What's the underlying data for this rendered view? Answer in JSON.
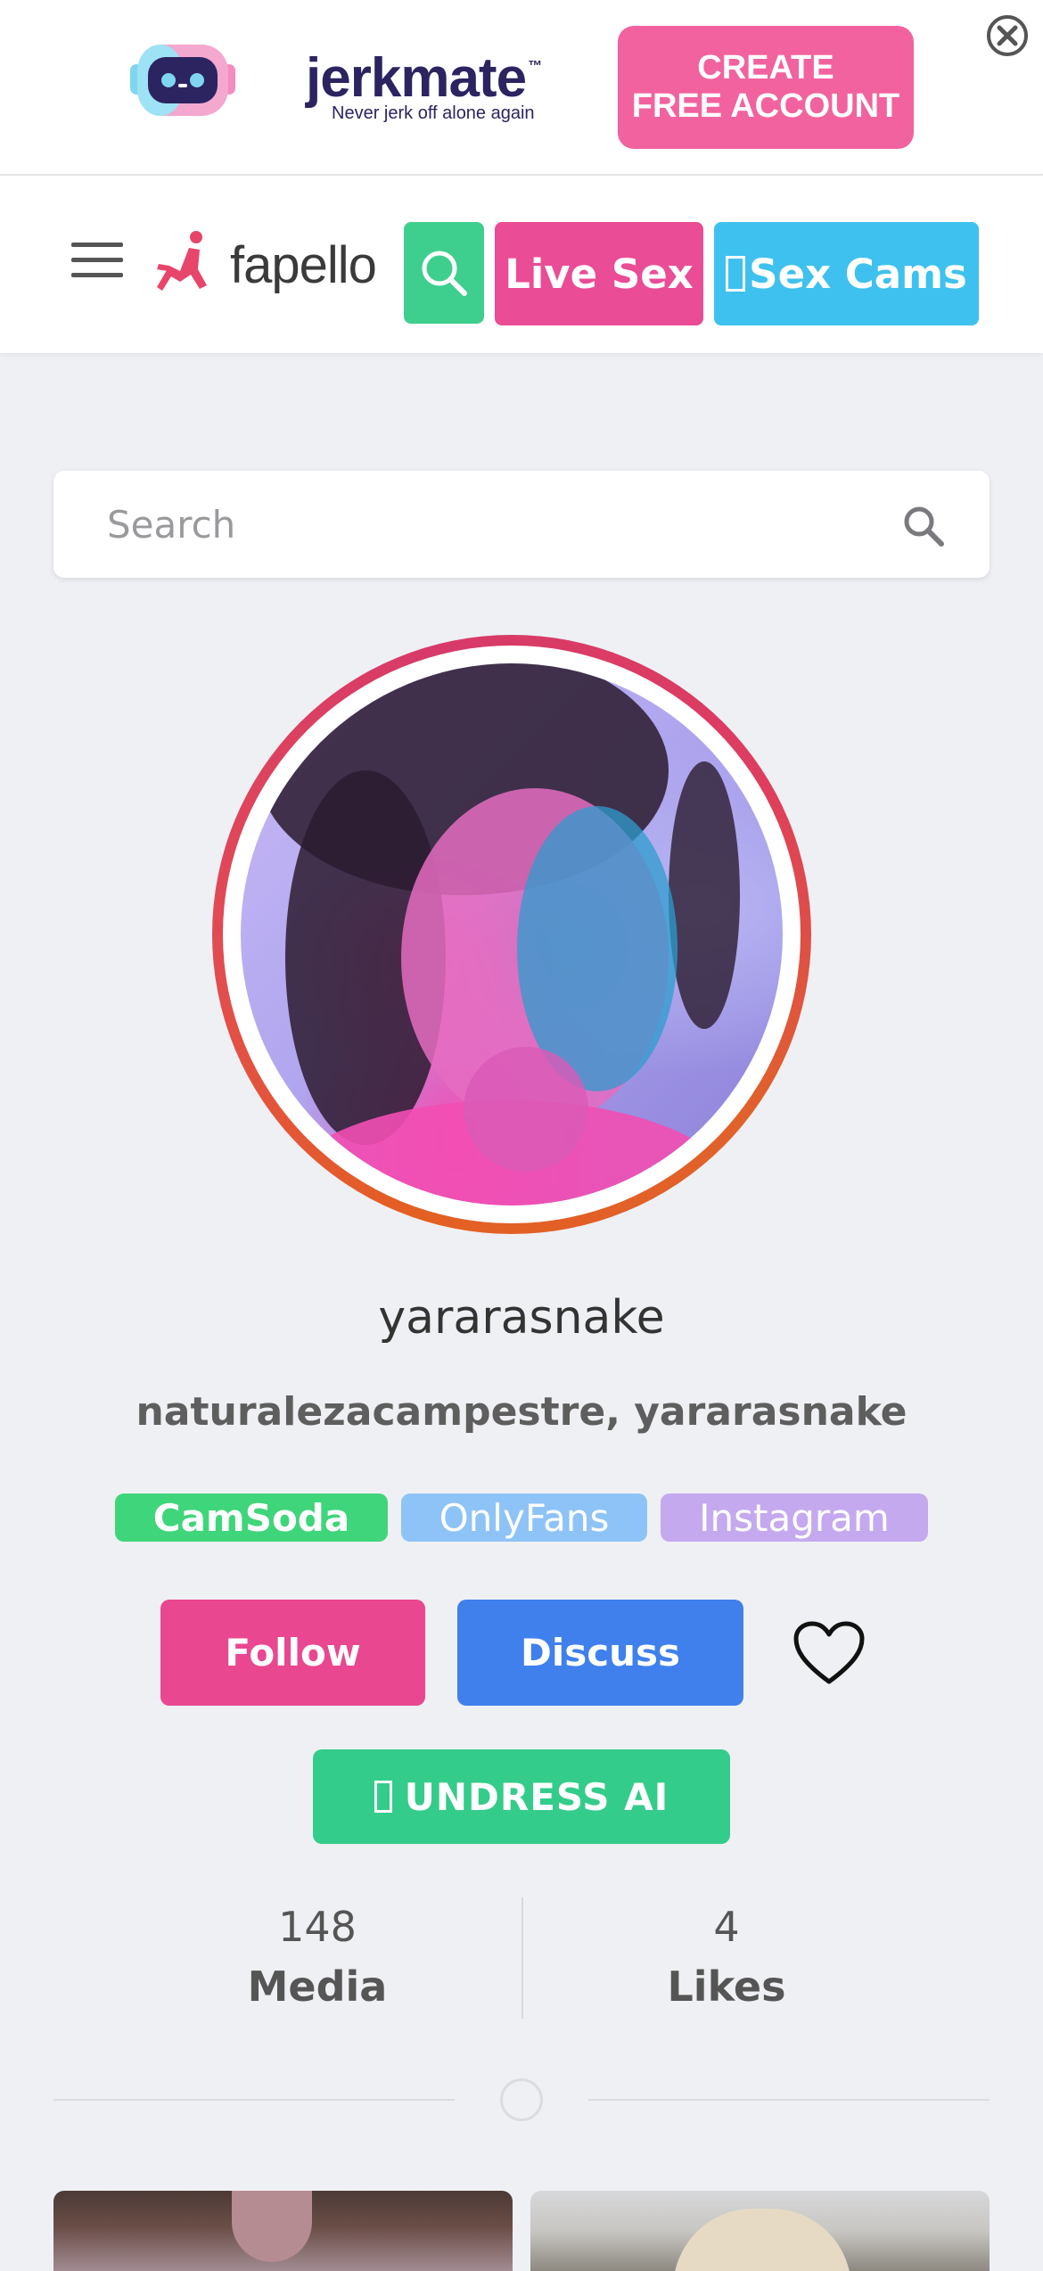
{
  "ad": {
    "brand": "jerkmate",
    "trademark": "™",
    "tagline": "Never jerk off alone again",
    "cta_line1": "CREATE",
    "cta_line2": "FREE ACCOUNT",
    "colors": {
      "brand": "#2b2461",
      "cta": "#f2629e"
    }
  },
  "nav": {
    "site_name": "fapello",
    "live_label": "Live Sex",
    "cams_label": "Sex Cams",
    "colors": {
      "search": "#3ecf8e",
      "live": "#ea4c96",
      "cams": "#3ec1ee"
    }
  },
  "search": {
    "placeholder": "Search"
  },
  "profile": {
    "username": "yararasnake",
    "aliases": "naturalezacampestre, yararasnake",
    "tags": [
      "CamSoda",
      "OnlyFans",
      "Instagram"
    ],
    "follow_label": "Follow",
    "discuss_label": "Discuss",
    "undress_label": "UNDRESS AI"
  },
  "stats": {
    "media_count": "148",
    "media_label": "Media",
    "likes_count": "4",
    "likes_label": "Likes"
  },
  "icons": [
    "robot-logo-icon",
    "close-icon",
    "menu-icon",
    "fapello-logo-icon",
    "search-icon",
    "heart-icon"
  ]
}
